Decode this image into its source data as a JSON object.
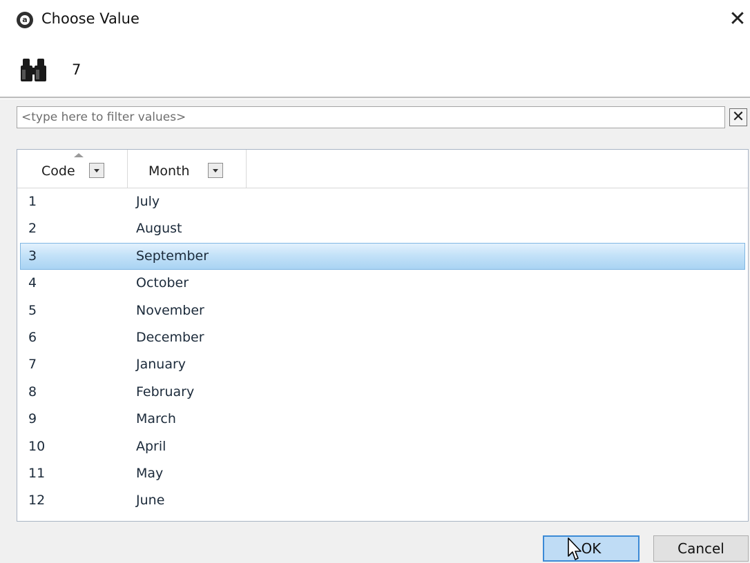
{
  "window": {
    "title": "Choose Value",
    "app_icon_letter": "a",
    "close_symbol": "✕"
  },
  "header": {
    "icon": "binoculars-icon",
    "value": "7"
  },
  "filter": {
    "placeholder": "<type here to filter values>",
    "value": "",
    "clear_symbol": "✕"
  },
  "grid": {
    "columns": [
      "Code",
      "Month"
    ],
    "sorted_column": "Code",
    "selected_row_index": 2,
    "selection_color": "#c4e2f8",
    "rows": [
      {
        "code": "1",
        "month": "July"
      },
      {
        "code": "2",
        "month": "August"
      },
      {
        "code": "3",
        "month": "September"
      },
      {
        "code": "4",
        "month": "October"
      },
      {
        "code": "5",
        "month": "November"
      },
      {
        "code": "6",
        "month": "December"
      },
      {
        "code": "7",
        "month": "January"
      },
      {
        "code": "8",
        "month": "February"
      },
      {
        "code": "9",
        "month": "March"
      },
      {
        "code": "10",
        "month": "April"
      },
      {
        "code": "11",
        "month": "May"
      },
      {
        "code": "12",
        "month": "June"
      }
    ]
  },
  "buttons": {
    "ok_label": "OK",
    "cancel_label": "Cancel"
  }
}
